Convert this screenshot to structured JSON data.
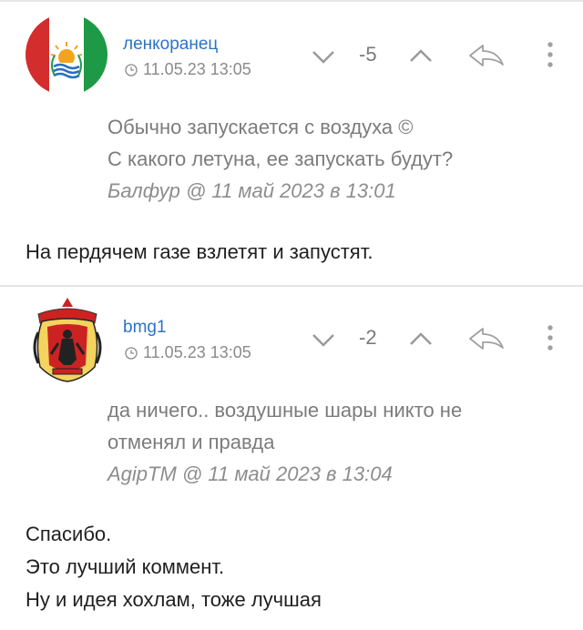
{
  "comments": [
    {
      "username": "ленкоранец",
      "timestamp": "11.05.23 13:05",
      "score": "-5",
      "quote_lines": [
        "Обычно запускается с воздуха ©",
        "С какого летуна, ее запускать будут?"
      ],
      "quote_author": "Балфур",
      "quote_date": "@ 11 май 2023 в 13:01",
      "body_lines": [
        "На пердячем газе взлетят и запустят."
      ],
      "avatar_icon": "flag-emblem-icon"
    },
    {
      "username": "bmg1",
      "timestamp": "11.05.23 13:05",
      "score": "-2",
      "quote_lines": [
        "да ничего.. воздушные шары никто не",
        "отменял и правда"
      ],
      "quote_author": "AgipTM",
      "quote_date": "@ 11 май 2023 в 13:04",
      "body_lines": [
        "Спасибо.",
        "Это лучший коммент.",
        "Ну и идея хохлам, тоже лучшая"
      ],
      "avatar_icon": "coat-of-arms-icon"
    }
  ],
  "colors": {
    "username": "#2b73c7",
    "meta": "#8a8a8a",
    "quote": "#7c7c7c",
    "divider": "#e6e6e6",
    "avatar1_red": "#d42d2d",
    "avatar1_green": "#1e9a46"
  }
}
